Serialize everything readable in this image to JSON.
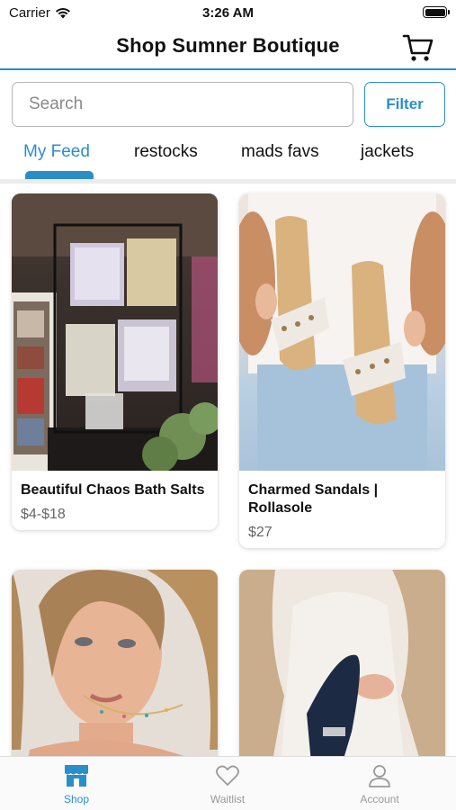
{
  "status_bar": {
    "carrier": "Carrier",
    "time": "3:26 AM"
  },
  "header": {
    "title": "Shop Sumner Boutique",
    "cart_icon": "cart-icon"
  },
  "search": {
    "placeholder": "Search",
    "value": "",
    "filter_label": "Filter"
  },
  "tabs": [
    {
      "label": "My Feed",
      "active": true
    },
    {
      "label": "restocks",
      "active": false
    },
    {
      "label": "mads favs",
      "active": false
    },
    {
      "label": "jackets",
      "active": false
    }
  ],
  "products": [
    {
      "name": "Beautiful Chaos Bath Salts",
      "price": "$4-$18",
      "image": "bath-salts-display-photo"
    },
    {
      "name": "Charmed Sandals | Rollasole",
      "price": "$27",
      "image": "studded-sandals-photo"
    },
    {
      "name": "",
      "price": "",
      "image": "necklace-model-photo"
    },
    {
      "name": "",
      "price": "",
      "image": "navy-boot-photo"
    }
  ],
  "bottom_nav": [
    {
      "label": "Shop",
      "icon": "storefront-icon",
      "active": true
    },
    {
      "label": "Waitlist",
      "icon": "heart-icon",
      "active": false
    },
    {
      "label": "Account",
      "icon": "person-icon",
      "active": false
    }
  ],
  "colors": {
    "accent": "#2a8fc9",
    "inactive_nav": "#999999"
  }
}
